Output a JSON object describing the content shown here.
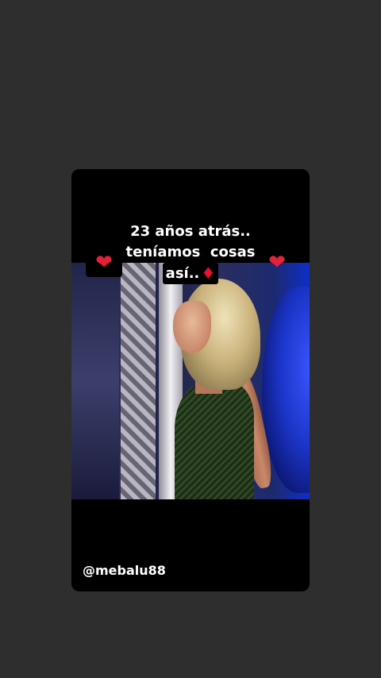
{
  "story": {
    "caption_line_1": "23 años atrás..",
    "caption_line_2": "teníamos  cosas",
    "caption_line_3": "así..",
    "caption_emoji": "♦",
    "heart_emoji": "❤",
    "username": "@mebalu88"
  },
  "icons": {
    "heart": "heart-icon",
    "diamond": "diamond-suit-icon"
  },
  "colors": {
    "background": "#2e2e2e",
    "card": "#000000",
    "text": "#ffffff",
    "heart": "#e5203a",
    "diamond": "#e8102d"
  }
}
